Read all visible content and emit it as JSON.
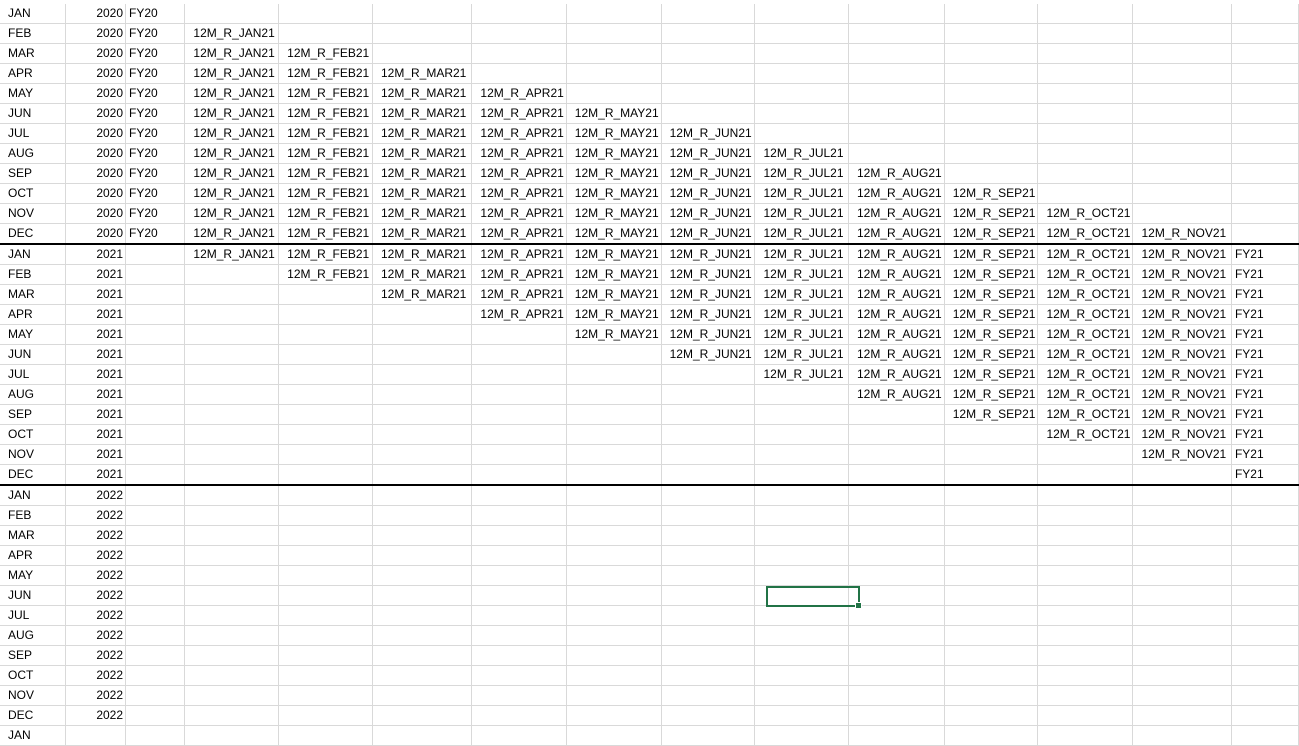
{
  "months": [
    "JAN",
    "FEB",
    "MAR",
    "APR",
    "MAY",
    "JUN",
    "JUL",
    "AUG",
    "SEP",
    "OCT",
    "NOV",
    "DEC"
  ],
  "years": [
    "2020",
    "2021",
    "2022"
  ],
  "fy_label_2020": "FY20",
  "fy_label_2021": "FY21",
  "rolling_labels": [
    "12M_R_JAN21",
    "12M_R_FEB21",
    "12M_R_MAR21",
    "12M_R_APR21",
    "12M_R_MAY21",
    "12M_R_JUN21",
    "12M_R_JUL21",
    "12M_R_AUG21",
    "12M_R_SEP21",
    "12M_R_OCT21",
    "12M_R_NOV21"
  ],
  "selected_cell": {
    "row": 29,
    "col": 9
  },
  "colors": {
    "gridline": "#d9d9d9",
    "selection": "#217346",
    "group_border": "#000000"
  }
}
